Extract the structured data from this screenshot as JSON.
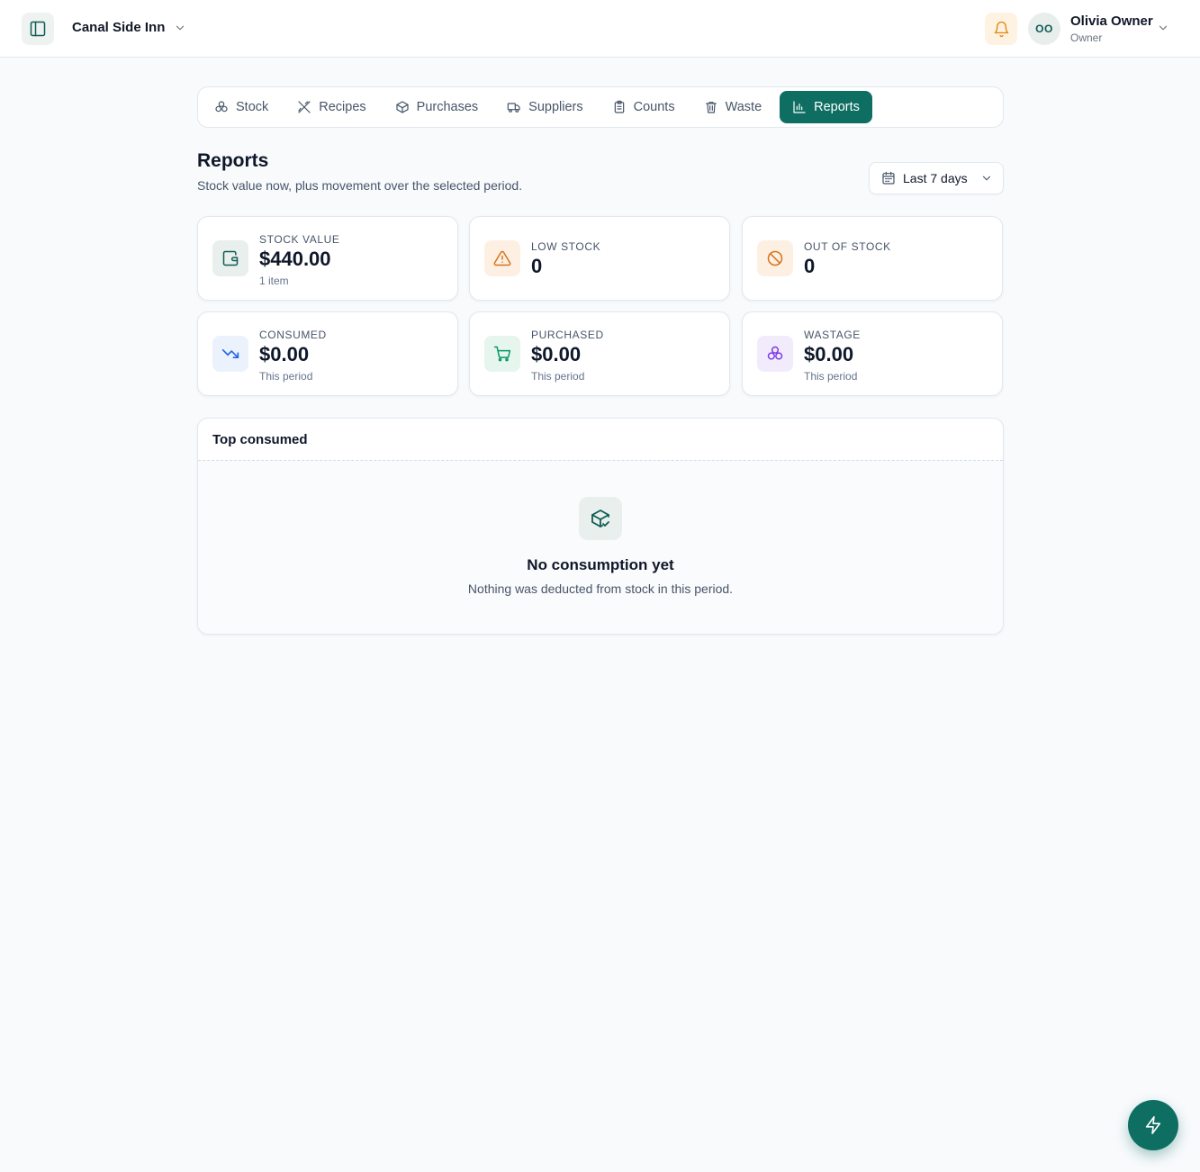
{
  "header": {
    "venue_name": "Canal Side Inn",
    "user_initials": "OO",
    "user_name": "Olivia Owner",
    "user_role": "Owner"
  },
  "tabs": [
    {
      "label": "Stock",
      "icon": "ingredients-icon",
      "active": false
    },
    {
      "label": "Recipes",
      "icon": "utensils-icon",
      "active": false
    },
    {
      "label": "Purchases",
      "icon": "package-icon",
      "active": false
    },
    {
      "label": "Suppliers",
      "icon": "truck-icon",
      "active": false
    },
    {
      "label": "Counts",
      "icon": "clipboard-icon",
      "active": false
    },
    {
      "label": "Waste",
      "icon": "trash-icon",
      "active": false
    },
    {
      "label": "Reports",
      "icon": "bar-chart-icon",
      "active": true
    }
  ],
  "page": {
    "title": "Reports",
    "subtitle": "Stock value now, plus movement over the selected period.",
    "period_label": "Last 7 days"
  },
  "stats": [
    {
      "label": "STOCK VALUE",
      "value": "$440.00",
      "hint": "1 item",
      "icon": "wallet-icon",
      "color": "#0f5c55"
    },
    {
      "label": "LOW STOCK",
      "value": "0",
      "hint": "",
      "icon": "warning-icon",
      "color": "#d9731a"
    },
    {
      "label": "OUT OF STOCK",
      "value": "0",
      "hint": "",
      "icon": "ban-icon",
      "color": "#d9731a"
    },
    {
      "label": "CONSUMED",
      "value": "$0.00",
      "hint": "This period",
      "icon": "trending-down-icon",
      "color": "#2563eb"
    },
    {
      "label": "PURCHASED",
      "value": "$0.00",
      "hint": "This period",
      "icon": "cart-icon",
      "color": "#059669"
    },
    {
      "label": "WASTAGE",
      "value": "$0.00",
      "hint": "This period",
      "icon": "ingredients-icon",
      "color": "#7c3aed"
    }
  ],
  "top_consumed": {
    "title": "Top consumed",
    "empty_title": "No consumption yet",
    "empty_text": "Nothing was deducted from stock in this period."
  },
  "colors": {
    "accent": "#0f6e62",
    "background": "#f8fafc"
  }
}
